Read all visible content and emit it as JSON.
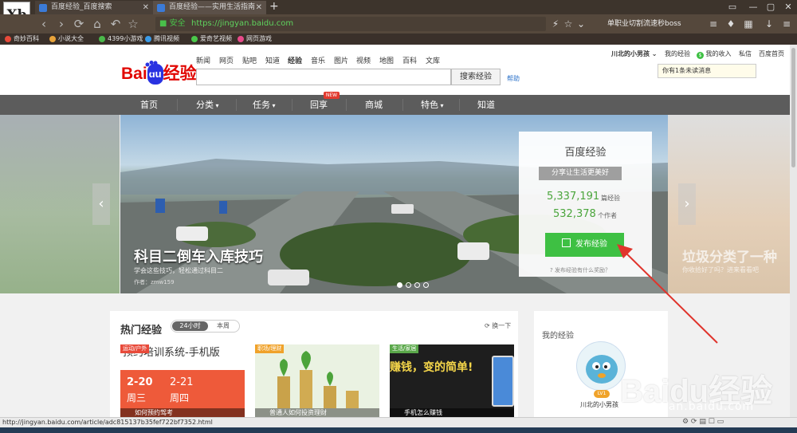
{
  "browser": {
    "logo_text": "Xb",
    "tabs": [
      {
        "title": "百度经验_百度搜索"
      },
      {
        "title": "百度经验——实用生活指南"
      }
    ],
    "new_tab": "+",
    "window_controls": [
      "▭",
      "—",
      "▢",
      "✕"
    ],
    "nav_icons": [
      "‹",
      "›",
      "⟳",
      "⌂",
      "↶",
      "☆"
    ],
    "secure_label": "安全",
    "url": "https://jingyan.baidu.com",
    "search_box": "单职业切割流速秒boss",
    "bookmarks": [
      "奇妙百科",
      "小说大全",
      "4399小游戏",
      "腾讯视频",
      "爱奇艺视频",
      "网页游戏"
    ]
  },
  "header": {
    "logo_text": "Bai",
    "logo_du": "du",
    "logo_jingyan": "经验",
    "categories": [
      "新闻",
      "网页",
      "贴吧",
      "知道",
      "经验",
      "音乐",
      "图片",
      "视频",
      "地图",
      "百科",
      "文库"
    ],
    "search_placeholder": "",
    "search_button": "搜索经验",
    "help": "帮助",
    "user_links": [
      "川北的小男孩",
      "我的经验",
      "我的收入",
      "私信",
      "百度首页"
    ],
    "message": "你有1条未读消息"
  },
  "menu": {
    "items": [
      "首页",
      "分类",
      "任务",
      "回享",
      "商城",
      "特色",
      "知道"
    ],
    "new_badge": "NEW"
  },
  "banner": {
    "title": "科目二倒车入库技巧",
    "subtitle": "学会这些技巧，轻松通过科目二",
    "author": "作者：zmw159",
    "right_preview_title": "垃圾分类了一种",
    "right_preview_sub": "你收拾好了吗？进来看看吧",
    "prev": "‹",
    "next": "›",
    "active_dot": 1
  },
  "panel": {
    "title": "百度经验",
    "slogan": "分享让生活更美好",
    "count1": "5,337,191",
    "count1_label": "篇经验",
    "count2": "532,378",
    "count2_label": "个作者",
    "publish_button": "发布经验",
    "publish_icon": "edit-icon",
    "reward_link": "发布经验有什么奖励？"
  },
  "hot": {
    "title": "热门经验",
    "tabs": [
      "24小时",
      "本周"
    ],
    "refresh": "换一下",
    "cards": [
      {
        "tag": "运动/户外",
        "headline": "预约培训系统-手机版",
        "date1": "2-20",
        "day1": "周三",
        "date2": "2-21",
        "day2": "周四",
        "caption": "如何预约驾考"
      },
      {
        "tag": "职场/理财",
        "caption": "普通人如何投资理财"
      },
      {
        "tag": "生活/家居",
        "headline": "赚钱，变的简单!",
        "caption": "手机怎么赚钱"
      }
    ]
  },
  "my_exp": {
    "title": "我的经验",
    "level": "LV1",
    "name": "川北的小男孩"
  },
  "watermark": {
    "main": "Baidu经验",
    "sub": "jingyan.baidu.com"
  },
  "status_url": "http://jingyan.baidu.com/article/adc815137b35fef722bf7352.html",
  "colors": {
    "accent_green": "#3ec043",
    "baidu_red": "#e10601",
    "baidu_blue": "#2932e1",
    "menu_gray": "#5c5c5c",
    "arrow_red": "#e0342c"
  }
}
